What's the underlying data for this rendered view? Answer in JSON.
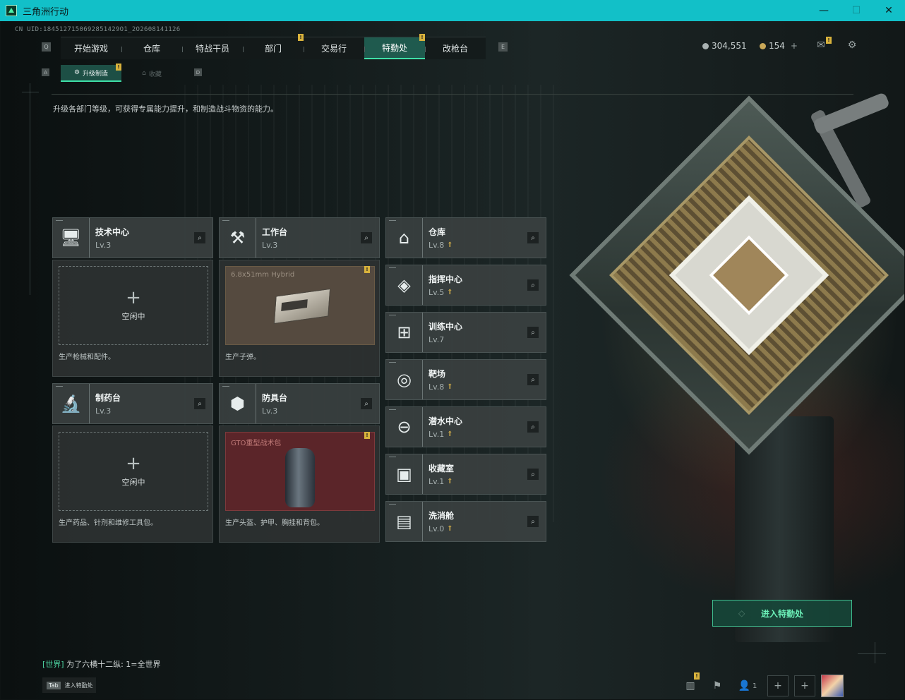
{
  "window": {
    "title": "三角洲行动",
    "minimize": "—",
    "maximize": "☐",
    "close": "✕"
  },
  "uid": "CN UID:1845127150692851429O1_2O2608141126",
  "nav": {
    "left_key": "Q",
    "right_key": "E",
    "tabs": [
      {
        "label": "开始游戏",
        "badge": ""
      },
      {
        "label": "仓库",
        "badge": ""
      },
      {
        "label": "特战干员",
        "badge": ""
      },
      {
        "label": "部门",
        "badge": "!"
      },
      {
        "label": "交易行",
        "badge": ""
      },
      {
        "label": "特勤处",
        "badge": "!",
        "active": true
      },
      {
        "label": "改枪台",
        "badge": ""
      }
    ]
  },
  "currency": {
    "silver": "304,551",
    "gold": "154",
    "gold_plus": "+"
  },
  "subnav": {
    "left_key": "A",
    "right_key": "D",
    "tabs": [
      {
        "label": "升级制造",
        "badge": "!",
        "active": true
      },
      {
        "label": "收藏"
      }
    ]
  },
  "description": "升级各部门等级，可获得专属能力提升，和制造战斗物资的能力。",
  "production": [
    {
      "name": "技术中心",
      "level": "Lv.3",
      "icon": "monitor-icon",
      "slot": "empty",
      "idle_label": "空闲中",
      "text": "生产枪械和配件。"
    },
    {
      "name": "工作台",
      "level": "Lv.3",
      "icon": "tools-icon",
      "slot": "ammo",
      "item": "6.8x51mm Hybrid",
      "badge": "!",
      "text": "生产子弹。"
    },
    {
      "name": "制药台",
      "level": "Lv.3",
      "icon": "microscope-icon",
      "slot": "empty",
      "idle_label": "空闲中",
      "text": "生产药品、针剂和维修工具包。"
    },
    {
      "name": "防具台",
      "level": "Lv.3",
      "icon": "cubes-icon",
      "slot": "bag",
      "item": "GTO重型战术包",
      "badge": "!",
      "text": "生产头盔、护甲、胸挂和背包。"
    }
  ],
  "departments": [
    {
      "name": "仓库",
      "level": "Lv.8",
      "upgrade": true,
      "icon": "warehouse-icon"
    },
    {
      "name": "指挥中心",
      "level": "Lv.5",
      "upgrade": true,
      "icon": "command-icon"
    },
    {
      "name": "训练中心",
      "level": "Lv.7",
      "upgrade": false,
      "icon": "dumbbell-icon"
    },
    {
      "name": "靶场",
      "level": "Lv.8",
      "upgrade": true,
      "icon": "target-icon"
    },
    {
      "name": "潜水中心",
      "level": "Lv.1",
      "upgrade": true,
      "icon": "diving-mask-icon"
    },
    {
      "name": "收藏室",
      "level": "Lv.1",
      "upgrade": true,
      "icon": "collection-icon"
    },
    {
      "name": "洗消舱",
      "level": "Lv.0",
      "upgrade": true,
      "icon": "decon-icon"
    }
  ],
  "enter_button": "进入特勤处",
  "chat": {
    "channel": "[世界]",
    "message": "为了六横十二纵: 1=全世界"
  },
  "tab_hint": {
    "key": "Tab",
    "label": "进入特勤处"
  },
  "bottom": {
    "friends_count": "1"
  },
  "colors": {
    "accent": "#3fe0a8",
    "titlebar": "#12c0c8",
    "badge": "#d8b23c",
    "upgrade": "#e0b84a"
  }
}
